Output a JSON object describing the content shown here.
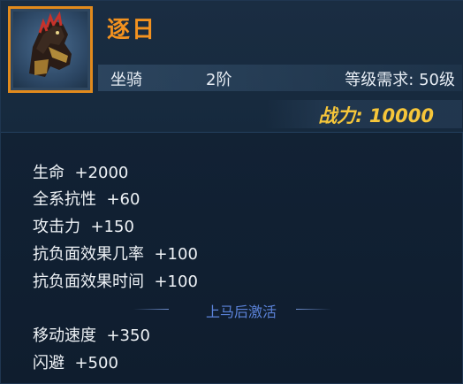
{
  "item": {
    "name": "逐日",
    "icon": "horse-mount-icon",
    "type": "坐骑",
    "tier": "2阶",
    "level_requirement": "等级需求: 50级",
    "combat_power": "战力: 10000"
  },
  "base_stats": [
    {
      "label": "生命",
      "value": "+2000"
    },
    {
      "label": "全系抗性",
      "value": "+60"
    },
    {
      "label": "攻击力",
      "value": "+150"
    },
    {
      "label": "抗负面效果几率",
      "value": "+100"
    },
    {
      "label": "抗负面效果时间",
      "value": "+100"
    }
  ],
  "mounted_section": {
    "title": "上马后激活",
    "stats": [
      {
        "label": "移动速度",
        "value": "+350"
      },
      {
        "label": "闪避",
        "value": "+500"
      }
    ]
  },
  "colors": {
    "name": "#f3921f",
    "power": "#f6c63a",
    "frame": "#e28a1c",
    "section": "#5b82d8"
  }
}
